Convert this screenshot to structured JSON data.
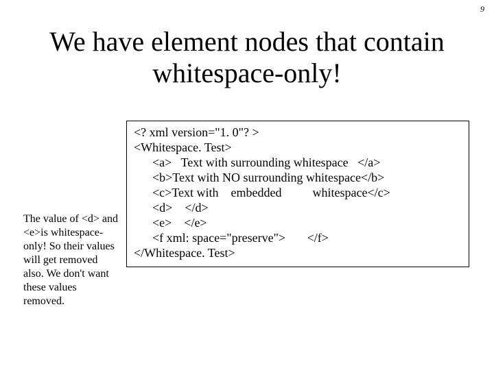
{
  "page_number": "9",
  "title": "We have element nodes that contain whitespace-only!",
  "side_note": "The value of <d> and <e>is whitespace-only! So their values will get removed also. We don't want these values removed.",
  "code": "<? xml version=\"1. 0\"? >\n<Whitespace. Test>\n      <a>   Text with surrounding whitespace   </a>\n      <b>Text with NO surrounding whitespace</b>\n      <c>Text with    embedded          whitespace</c>\n      <d>    </d>\n      <e>    </e>\n      <f xml: space=\"preserve\">       </f>\n</Whitespace. Test>"
}
